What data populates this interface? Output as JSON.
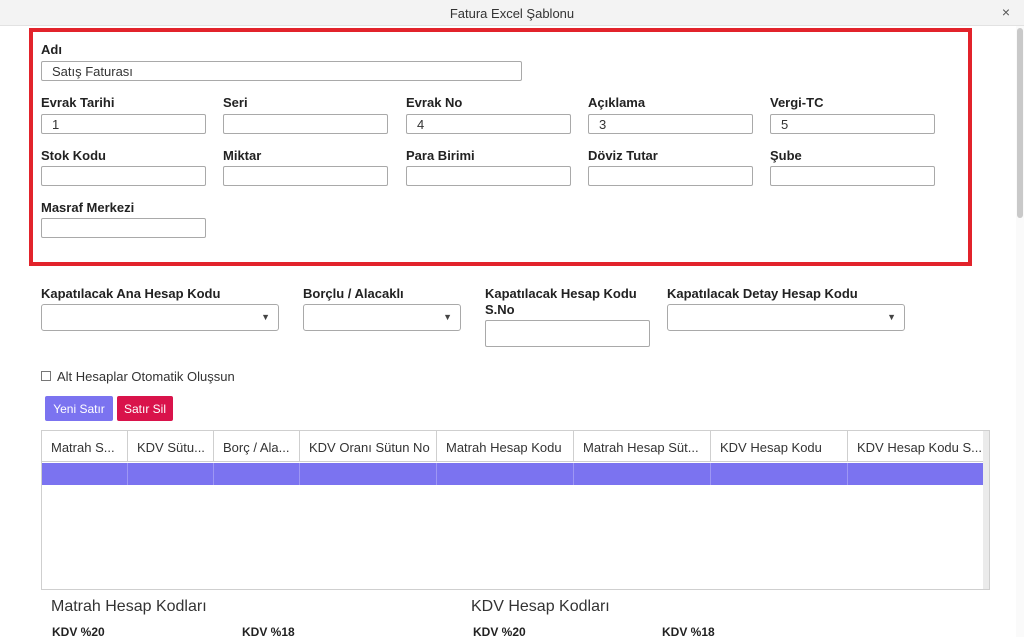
{
  "window": {
    "title": "Fatura Excel Şablonu",
    "close_glyph": "×"
  },
  "form": {
    "name": {
      "label": "Adı",
      "value": "Satış Faturası"
    },
    "fields_row1": [
      {
        "label": "Evrak Tarihi",
        "value": "1"
      },
      {
        "label": "Seri",
        "value": ""
      },
      {
        "label": "Evrak No",
        "value": "4"
      },
      {
        "label": "Açıklama",
        "value": "3"
      },
      {
        "label": "Vergi-TC",
        "value": "5"
      }
    ],
    "fields_row2": [
      {
        "label": "Stok Kodu",
        "value": ""
      },
      {
        "label": "Miktar",
        "value": ""
      },
      {
        "label": "Para Birimi",
        "value": ""
      },
      {
        "label": "Döviz Tutar",
        "value": ""
      },
      {
        "label": "Şube",
        "value": ""
      }
    ],
    "masraf": {
      "label": "Masraf Merkezi",
      "value": ""
    }
  },
  "selects": {
    "ana_hesap": {
      "label": "Kapatılacak Ana Hesap Kodu",
      "value": ""
    },
    "borclu": {
      "label": "Borçlu / Alacaklı",
      "value": ""
    },
    "hesap_sno": {
      "label_line1": "Kapatılacak Hesap Kodu",
      "label_line2": "S.No",
      "value": ""
    },
    "detay_hesap": {
      "label": "Kapatılacak Detay Hesap Kodu",
      "value": ""
    },
    "arrow_glyph": "▼"
  },
  "checkbox": {
    "label": "Alt Hesaplar Otomatik Oluşsun",
    "checked": false
  },
  "buttons": {
    "new_row": "Yeni Satır",
    "delete_row": "Satır Sil"
  },
  "colors": {
    "accent": "#7b73f0",
    "danger": "#d9134b",
    "highlight_border": "#e2232b"
  },
  "grid": {
    "columns": [
      "Matrah S...",
      "KDV Sütu...",
      "Borç / Ala...",
      "KDV Oranı Sütun No",
      "Matrah Hesap Kodu",
      "Matrah Hesap Süt...",
      "KDV Hesap Kodu",
      "KDV Hesap Kodu S..."
    ],
    "rows": [
      [
        "",
        "",
        "",
        "",
        "",
        "",
        "",
        ""
      ]
    ]
  },
  "sections": {
    "matrah": {
      "title": "Matrah Hesap Kodları",
      "items": [
        "KDV %20",
        "KDV %18"
      ]
    },
    "kdv": {
      "title": "KDV Hesap Kodları",
      "items": [
        "KDV %20",
        "KDV %18"
      ]
    }
  }
}
